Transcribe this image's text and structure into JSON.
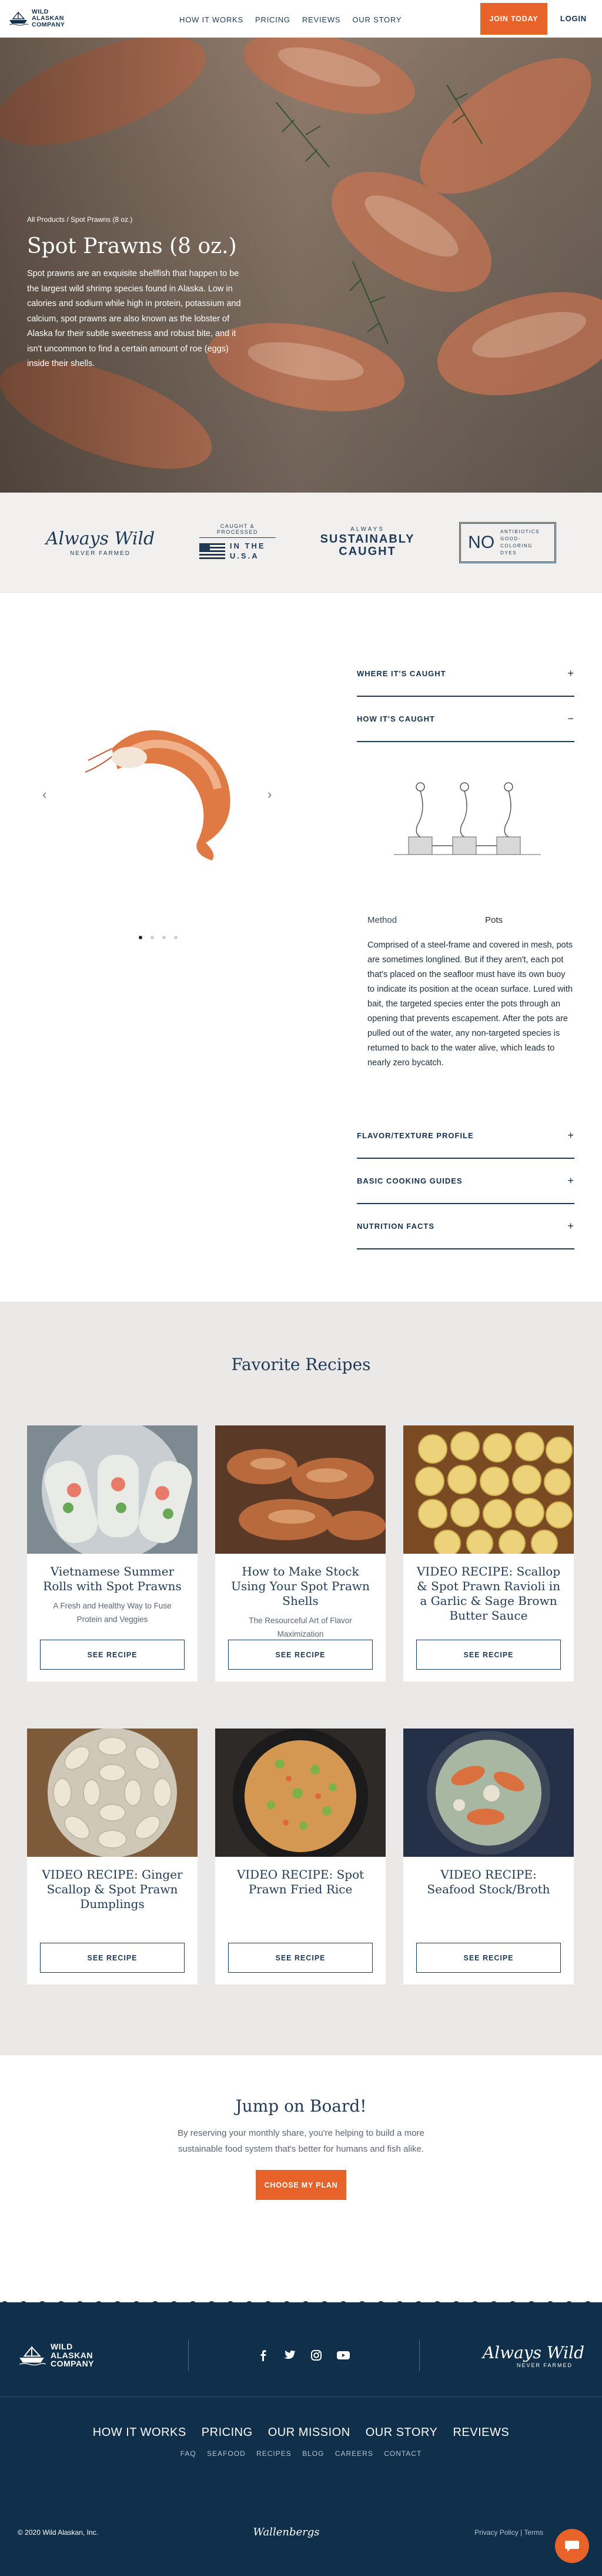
{
  "nav": {
    "logo_lines": [
      "WILD",
      "ALASKAN",
      "COMPANY"
    ],
    "links": [
      "HOW IT WORKS",
      "PRICING",
      "REVIEWS",
      "OUR STORY"
    ],
    "join": "JOIN TODAY",
    "login": "LOGIN"
  },
  "hero": {
    "breadcrumb": "All Products / Spot Prawns (8 oz.)",
    "title": "Spot Prawns (8 oz.)",
    "description": "Spot prawns are an exquisite shellfish that happen to be the largest wild shrimp species found in Alaska. Low in calories and sodium while high in protein, potassium and calcium, spot prawns are also known as the lobster of Alaska for their subtle sweetness and robust bite, and it isn't uncommon to find a certain amount of roe (eggs) inside their shells."
  },
  "badges": {
    "always_wild": "Always Wild",
    "never_farmed": "NEVER FARMED",
    "caught_processed": "CAUGHT & PROCESSED",
    "in_the": "IN THE",
    "usa": "U.S.A",
    "always": "ALWAYS",
    "sustainably": "SUSTAINABLY",
    "caught": "CAUGHT",
    "no": "NO",
    "no_text": "ANTIBIOTICS GOOD-COLORING DYES"
  },
  "product": {
    "prev": "‹",
    "next": "›",
    "accordion": [
      {
        "label": "WHERE IT'S CAUGHT",
        "state": "+"
      },
      {
        "label": "HOW IT'S CAUGHT",
        "state": "−"
      },
      {
        "label": "FLAVOR/TEXTURE PROFILE",
        "state": "+"
      },
      {
        "label": "BASIC COOKING GUIDES",
        "state": "+"
      },
      {
        "label": "NUTRITION FACTS",
        "state": "+"
      }
    ],
    "method_label": "Method",
    "method_value": "Pots",
    "method_desc": "Comprised of a steel-frame and covered in mesh, pots are sometimes longlined. But if they aren't, each pot that's placed on the seafloor must have its own buoy to indicate its position at the ocean surface. Lured with bait, the targeted species enter the pots through an opening that prevents escapement. After the pots are pulled out of the water, any non-targeted species is returned to back to the water alive, which leads to nearly zero bycatch."
  },
  "recipes": {
    "title": "Favorite Recipes",
    "button": "SEE RECIPE",
    "items": [
      {
        "title": "Vietnamese Summer Rolls with Spot Prawns",
        "subtitle": "A Fresh and Healthy Way to Fuse Protein and Veggies"
      },
      {
        "title": "How to Make Stock Using Your Spot Prawn Shells",
        "subtitle": "The Resourceful Art of Flavor Maximization"
      },
      {
        "title": "VIDEO RECIPE: Scallop & Spot Prawn Ravioli in a Garlic & Sage Brown Butter Sauce",
        "subtitle": ""
      },
      {
        "title": "VIDEO RECIPE: Ginger Scallop & Spot Prawn Dumplings",
        "subtitle": ""
      },
      {
        "title": "VIDEO RECIPE: Spot Prawn Fried Rice",
        "subtitle": ""
      },
      {
        "title": "VIDEO RECIPE: Seafood Stock/Broth",
        "subtitle": ""
      }
    ]
  },
  "jump": {
    "title": "Jump on Board!",
    "text": "By reserving your monthly share, you're helping to build a more sustainable food system that's better for humans and fish alike.",
    "button": "CHOOSE MY PLAN"
  },
  "footer": {
    "logo_lines": [
      "WILD",
      "ALASKAN",
      "COMPANY"
    ],
    "always_wild": "Always Wild",
    "never_farmed": "NEVER FARMED",
    "main_links": [
      "HOW IT WORKS",
      "PRICING",
      "OUR MISSION",
      "OUR STORY",
      "REVIEWS"
    ],
    "small_links": [
      "FAQ",
      "SEAFOOD",
      "RECIPES",
      "BLOG",
      "CAREERS",
      "CONTACT"
    ],
    "copyright": "© 2020 Wild Alaskan, Inc.",
    "brand": "Wallenbergs",
    "legal": "Privacy Policy | Terms"
  }
}
